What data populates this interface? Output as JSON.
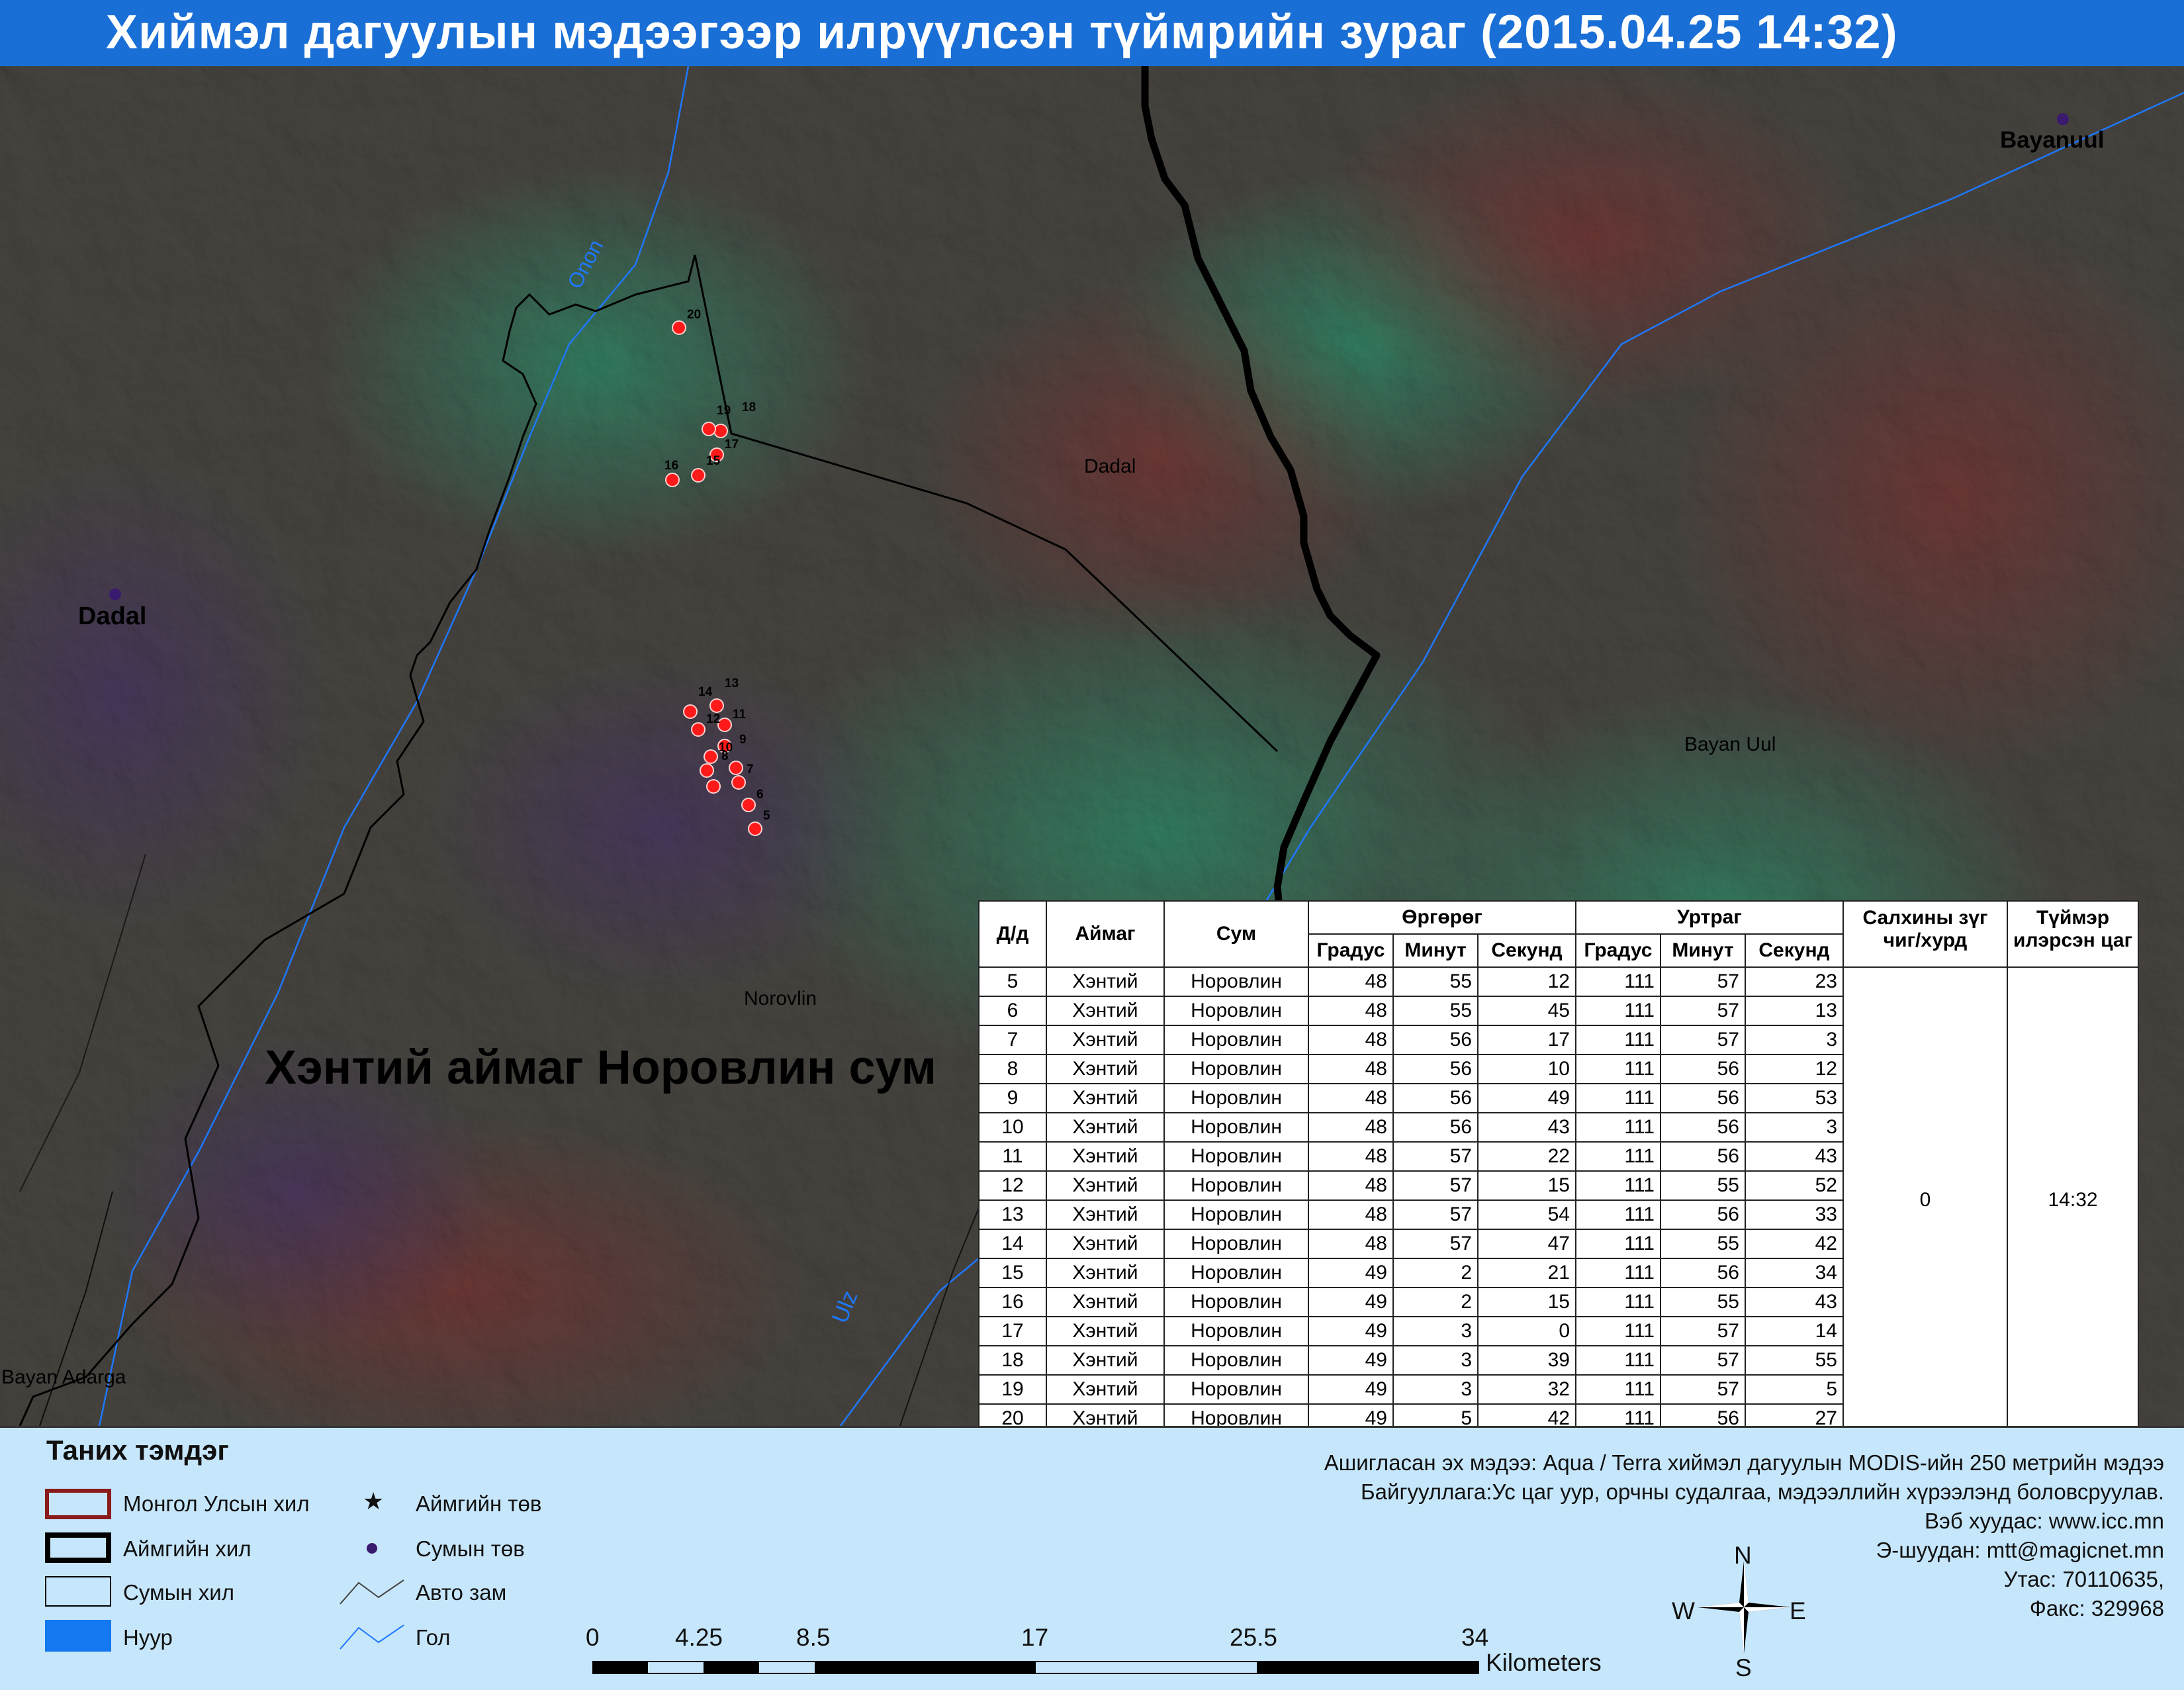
{
  "title": "Хиймэл дагуулын мэдээгээр илрүүлсэн түймрийн зураг  (2015.04.25 14:32)",
  "map": {
    "place_labels": [
      {
        "text": "Bayanuul",
        "kind": "soum-center"
      },
      {
        "text": "Dadal",
        "kind": "soum-center"
      },
      {
        "text": "Dadal",
        "kind": "soum-area"
      },
      {
        "text": "Bayan Uul",
        "kind": "soum-area"
      },
      {
        "text": "Norovlin",
        "kind": "soum-area"
      },
      {
        "text": "Bayan Adarga",
        "kind": "soum-area"
      }
    ],
    "river_labels": [
      "Onon",
      "Ulz"
    ],
    "region_label": "Хэнтий аймаг Норовлин сум",
    "hotspot_ids": [
      "5",
      "6",
      "7",
      "8",
      "9",
      "10",
      "11",
      "12",
      "13",
      "14",
      "15",
      "16",
      "17",
      "18",
      "19",
      "20"
    ],
    "colors": {
      "hotspot": "#ff1a1a",
      "river": "#1e78ff",
      "aimag_border": "#000000",
      "soum_border": "#000000",
      "soum_center": "#3a1a6e"
    }
  },
  "table": {
    "headers": {
      "id": "Д/д",
      "aimag": "Аймаг",
      "sum": "Сум",
      "lat": "Өргөрөг",
      "lon": "Уртраг",
      "deg": "Градус",
      "min": "Минут",
      "sec": "Секунд",
      "wind": [
        "Салхины зүг",
        "чиг/хурд"
      ],
      "time": [
        "Түймэр",
        "илэрсэн цаг"
      ]
    },
    "rows": [
      [
        "5",
        "Хэнтий",
        "Норовлин",
        "48",
        "55",
        "12",
        "111",
        "57",
        "23"
      ],
      [
        "6",
        "Хэнтий",
        "Норовлин",
        "48",
        "55",
        "45",
        "111",
        "57",
        "13"
      ],
      [
        "7",
        "Хэнтий",
        "Норовлин",
        "48",
        "56",
        "17",
        "111",
        "57",
        "3"
      ],
      [
        "8",
        "Хэнтий",
        "Норовлин",
        "48",
        "56",
        "10",
        "111",
        "56",
        "12"
      ],
      [
        "9",
        "Хэнтий",
        "Норовлин",
        "48",
        "56",
        "49",
        "111",
        "56",
        "53"
      ],
      [
        "10",
        "Хэнтий",
        "Норовлин",
        "48",
        "56",
        "43",
        "111",
        "56",
        "3"
      ],
      [
        "11",
        "Хэнтий",
        "Норовлин",
        "48",
        "57",
        "22",
        "111",
        "56",
        "43"
      ],
      [
        "12",
        "Хэнтий",
        "Норовлин",
        "48",
        "57",
        "15",
        "111",
        "55",
        "52"
      ],
      [
        "13",
        "Хэнтий",
        "Норовлин",
        "48",
        "57",
        "54",
        "111",
        "56",
        "33"
      ],
      [
        "14",
        "Хэнтий",
        "Норовлин",
        "48",
        "57",
        "47",
        "111",
        "55",
        "42"
      ],
      [
        "15",
        "Хэнтий",
        "Норовлин",
        "49",
        "2",
        "21",
        "111",
        "56",
        "34"
      ],
      [
        "16",
        "Хэнтий",
        "Норовлин",
        "49",
        "2",
        "15",
        "111",
        "55",
        "43"
      ],
      [
        "17",
        "Хэнтий",
        "Норовлин",
        "49",
        "3",
        "0",
        "111",
        "57",
        "14"
      ],
      [
        "18",
        "Хэнтий",
        "Норовлин",
        "49",
        "3",
        "39",
        "111",
        "57",
        "55"
      ],
      [
        "19",
        "Хэнтий",
        "Норовлин",
        "49",
        "3",
        "32",
        "111",
        "57",
        "5"
      ],
      [
        "20",
        "Хэнтий",
        "Норовлин",
        "49",
        "5",
        "42",
        "111",
        "56",
        "27"
      ]
    ],
    "wind_value": "0",
    "time_value": "14:32"
  },
  "legend": {
    "title": "Таних тэмдэг",
    "items": [
      {
        "symbol": "red-outline-box",
        "label": "Монгол Улсын хил"
      },
      {
        "symbol": "thick-black-outline-box",
        "label": "Аймгийн хил"
      },
      {
        "symbol": "thin-black-outline-box",
        "label": "Сумын хил"
      },
      {
        "symbol": "blue-filled-box",
        "label": "Нуур"
      },
      {
        "symbol": "star-icon",
        "label": "Аймгийн төв"
      },
      {
        "symbol": "purple-dot-icon",
        "label": "Сумын төв"
      },
      {
        "symbol": "road-line-icon",
        "label": "Авто зам"
      },
      {
        "symbol": "river-line-icon",
        "label": "Гол"
      }
    ]
  },
  "info": [
    "Ашигласан эх мэдээ: Aqua / Terra хиймэл дагуулын MODIS-ийн 250 метрийн мэдээ",
    "Байгууллага:Ус цаг уур, орчны судалгаа, мэдээллийн хүрээлэнд боловсруулав.",
    "Вэб хуудас: www.icc.mn",
    "Э-шуудан: mtt@magicnet.mn",
    "Утас: 70110635,",
    "Факс: 329968"
  ],
  "scale_bar": {
    "ticks": [
      "0",
      "4.25",
      "8.5",
      "17",
      "25.5",
      "34"
    ],
    "unit": "Kilometers"
  },
  "compass": {
    "n": "N",
    "s": "S",
    "e": "E",
    "w": "W"
  }
}
